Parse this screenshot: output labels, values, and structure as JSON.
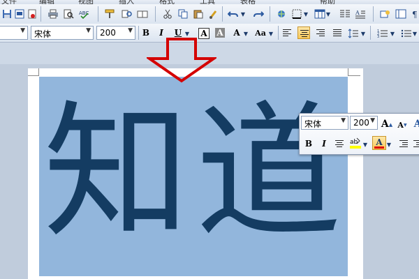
{
  "menubar": {
    "items": [
      "文件",
      "编辑",
      "视图",
      "插入",
      "格式",
      "工具",
      "表格",
      "帮助"
    ]
  },
  "formatting": {
    "font_name": "宋体",
    "font_size": "200",
    "bold_label": "B",
    "italic_label": "I",
    "underline_label": "U",
    "char_border_label": "A",
    "char_shading_label": "A",
    "char_scale_label": "A",
    "change_case_label": "Aa"
  },
  "document": {
    "selected_text": "知道"
  },
  "mini_toolbar": {
    "font_name": "宋体",
    "font_size": "200",
    "grow_font_label": "A",
    "shrink_font_label": "A",
    "bold_label": "B",
    "italic_label": "I",
    "font_color_label": "A"
  },
  "colors": {
    "selection": "#92b6dc",
    "text": "#143c62",
    "arrow": "#d40000",
    "highlight": "#ffff00",
    "font_color_bar": "#e00000"
  }
}
